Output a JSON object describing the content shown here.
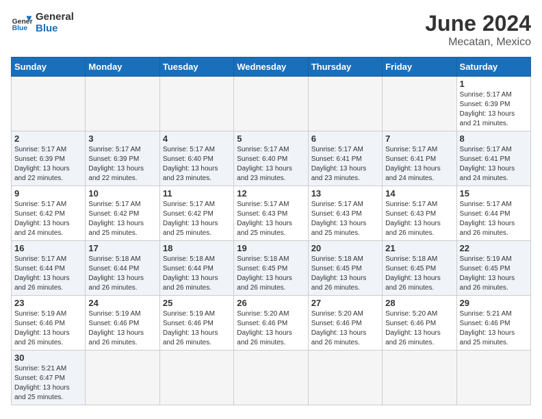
{
  "header": {
    "logo_general": "General",
    "logo_blue": "Blue",
    "month_year": "June 2024",
    "location": "Mecatan, Mexico"
  },
  "weekdays": [
    "Sunday",
    "Monday",
    "Tuesday",
    "Wednesday",
    "Thursday",
    "Friday",
    "Saturday"
  ],
  "days": [
    {
      "date": null,
      "info": null
    },
    {
      "date": null,
      "info": null
    },
    {
      "date": null,
      "info": null
    },
    {
      "date": null,
      "info": null
    },
    {
      "date": null,
      "info": null
    },
    {
      "date": null,
      "info": null
    },
    {
      "date": "1",
      "info": "Sunrise: 5:17 AM\nSunset: 6:39 PM\nDaylight: 13 hours and 21 minutes."
    },
    {
      "date": "2",
      "info": "Sunrise: 5:17 AM\nSunset: 6:39 PM\nDaylight: 13 hours and 22 minutes."
    },
    {
      "date": "3",
      "info": "Sunrise: 5:17 AM\nSunset: 6:39 PM\nDaylight: 13 hours and 22 minutes."
    },
    {
      "date": "4",
      "info": "Sunrise: 5:17 AM\nSunset: 6:40 PM\nDaylight: 13 hours and 23 minutes."
    },
    {
      "date": "5",
      "info": "Sunrise: 5:17 AM\nSunset: 6:40 PM\nDaylight: 13 hours and 23 minutes."
    },
    {
      "date": "6",
      "info": "Sunrise: 5:17 AM\nSunset: 6:41 PM\nDaylight: 13 hours and 23 minutes."
    },
    {
      "date": "7",
      "info": "Sunrise: 5:17 AM\nSunset: 6:41 PM\nDaylight: 13 hours and 24 minutes."
    },
    {
      "date": "8",
      "info": "Sunrise: 5:17 AM\nSunset: 6:41 PM\nDaylight: 13 hours and 24 minutes."
    },
    {
      "date": "9",
      "info": "Sunrise: 5:17 AM\nSunset: 6:42 PM\nDaylight: 13 hours and 24 minutes."
    },
    {
      "date": "10",
      "info": "Sunrise: 5:17 AM\nSunset: 6:42 PM\nDaylight: 13 hours and 25 minutes."
    },
    {
      "date": "11",
      "info": "Sunrise: 5:17 AM\nSunset: 6:42 PM\nDaylight: 13 hours and 25 minutes."
    },
    {
      "date": "12",
      "info": "Sunrise: 5:17 AM\nSunset: 6:43 PM\nDaylight: 13 hours and 25 minutes."
    },
    {
      "date": "13",
      "info": "Sunrise: 5:17 AM\nSunset: 6:43 PM\nDaylight: 13 hours and 25 minutes."
    },
    {
      "date": "14",
      "info": "Sunrise: 5:17 AM\nSunset: 6:43 PM\nDaylight: 13 hours and 26 minutes."
    },
    {
      "date": "15",
      "info": "Sunrise: 5:17 AM\nSunset: 6:44 PM\nDaylight: 13 hours and 26 minutes."
    },
    {
      "date": "16",
      "info": "Sunrise: 5:17 AM\nSunset: 6:44 PM\nDaylight: 13 hours and 26 minutes."
    },
    {
      "date": "17",
      "info": "Sunrise: 5:18 AM\nSunset: 6:44 PM\nDaylight: 13 hours and 26 minutes."
    },
    {
      "date": "18",
      "info": "Sunrise: 5:18 AM\nSunset: 6:44 PM\nDaylight: 13 hours and 26 minutes."
    },
    {
      "date": "19",
      "info": "Sunrise: 5:18 AM\nSunset: 6:45 PM\nDaylight: 13 hours and 26 minutes."
    },
    {
      "date": "20",
      "info": "Sunrise: 5:18 AM\nSunset: 6:45 PM\nDaylight: 13 hours and 26 minutes."
    },
    {
      "date": "21",
      "info": "Sunrise: 5:18 AM\nSunset: 6:45 PM\nDaylight: 13 hours and 26 minutes."
    },
    {
      "date": "22",
      "info": "Sunrise: 5:19 AM\nSunset: 6:45 PM\nDaylight: 13 hours and 26 minutes."
    },
    {
      "date": "23",
      "info": "Sunrise: 5:19 AM\nSunset: 6:46 PM\nDaylight: 13 hours and 26 minutes."
    },
    {
      "date": "24",
      "info": "Sunrise: 5:19 AM\nSunset: 6:46 PM\nDaylight: 13 hours and 26 minutes."
    },
    {
      "date": "25",
      "info": "Sunrise: 5:19 AM\nSunset: 6:46 PM\nDaylight: 13 hours and 26 minutes."
    },
    {
      "date": "26",
      "info": "Sunrise: 5:20 AM\nSunset: 6:46 PM\nDaylight: 13 hours and 26 minutes."
    },
    {
      "date": "27",
      "info": "Sunrise: 5:20 AM\nSunset: 6:46 PM\nDaylight: 13 hours and 26 minutes."
    },
    {
      "date": "28",
      "info": "Sunrise: 5:20 AM\nSunset: 6:46 PM\nDaylight: 13 hours and 26 minutes."
    },
    {
      "date": "29",
      "info": "Sunrise: 5:21 AM\nSunset: 6:46 PM\nDaylight: 13 hours and 25 minutes."
    },
    {
      "date": "30",
      "info": "Sunrise: 5:21 AM\nSunset: 6:47 PM\nDaylight: 13 hours and 25 minutes."
    }
  ]
}
